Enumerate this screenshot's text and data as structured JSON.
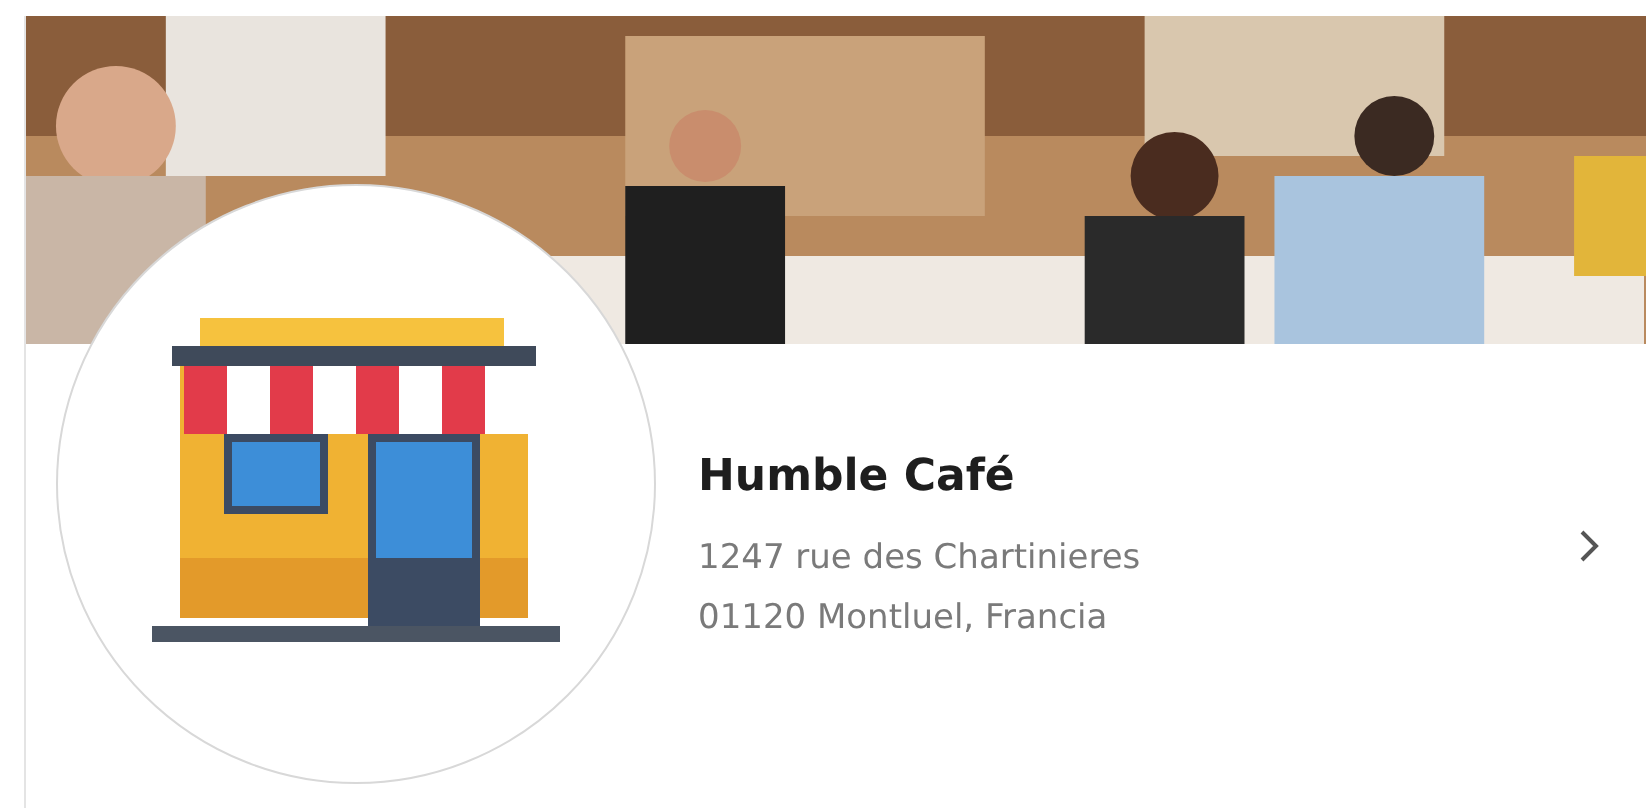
{
  "place": {
    "name": "Humble Café",
    "address_lines": [
      "1247 rue des Chartinieres",
      "01120 Montluel, Francia"
    ]
  }
}
